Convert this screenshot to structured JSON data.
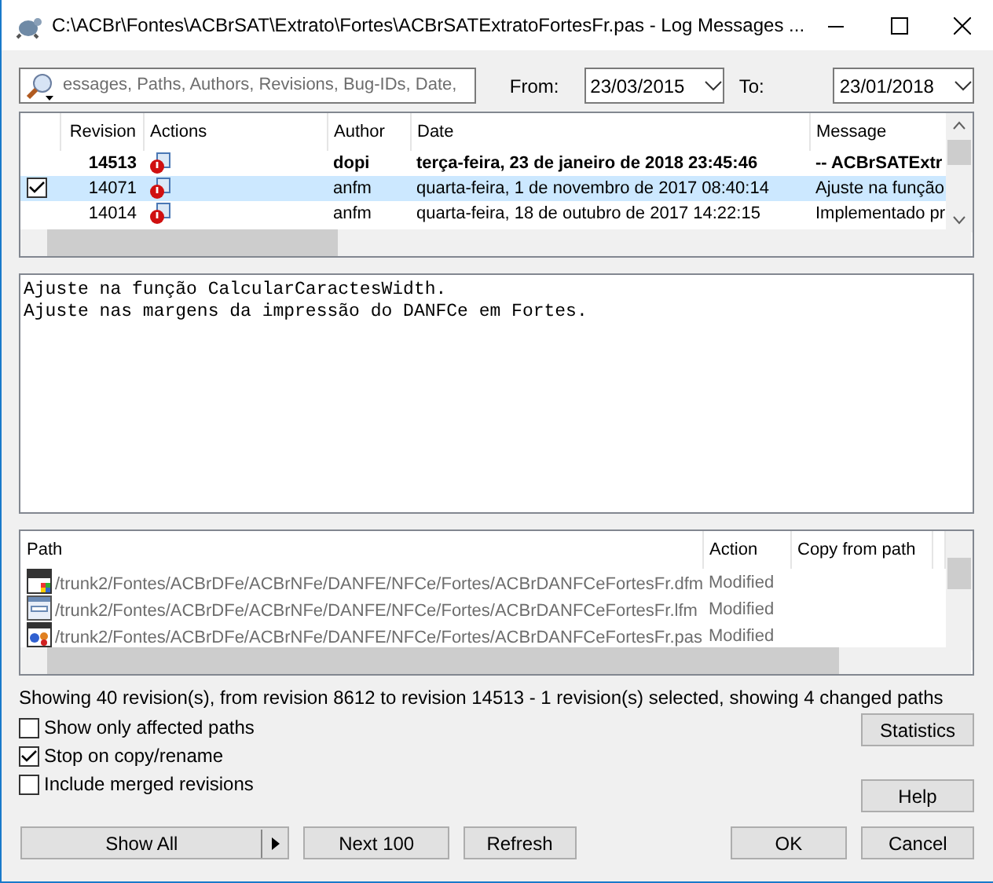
{
  "window": {
    "title": "C:\\ACBr\\Fontes\\ACBrSAT\\Extrato\\Fortes\\ACBrSATExtratoFortesFr.pas - Log Messages ..."
  },
  "filter": {
    "placeholder": "essages, Paths, Authors, Revisions, Bug-IDs, Date,"
  },
  "date_from": {
    "label": "From:",
    "value": "23/03/2015"
  },
  "date_to": {
    "label": "To:",
    "value": "23/01/2018"
  },
  "revisions": {
    "columns": [
      "Revision",
      "Actions",
      "Author",
      "Date",
      "Message"
    ],
    "rows": [
      {
        "revision": "14513",
        "author": "dopi",
        "date": "terça-feira, 23 de janeiro de 2018 23:45:46",
        "message": "-- ACBrSATExtr",
        "bold": true,
        "checked": false,
        "selected": false
      },
      {
        "revision": "14071",
        "author": "anfm",
        "date": "quarta-feira, 1 de novembro de 2017 08:40:14",
        "message": "Ajuste na função",
        "bold": false,
        "checked": true,
        "selected": true
      },
      {
        "revision": "14014",
        "author": "anfm",
        "date": "quarta-feira, 18 de outubro de 2017 14:22:15",
        "message": "Implementado pr",
        "bold": false,
        "checked": false,
        "selected": false
      }
    ]
  },
  "message": [
    "Ajuste na função CalcularCaractesWidth.",
    "Ajuste nas margens da impressão do DANFCe em Fortes."
  ],
  "paths": {
    "columns": [
      "Path",
      "Action",
      "Copy from path"
    ],
    "rows": [
      {
        "kind": "dfm",
        "path": "/trunk2/Fontes/ACBrDFe/ACBrNFe/DANFE/NFCe/Fortes/ACBrDANFCeFortesFr.dfm",
        "action": "Modified"
      },
      {
        "kind": "lfm",
        "path": "/trunk2/Fontes/ACBrDFe/ACBrNFe/DANFE/NFCe/Fortes/ACBrDANFCeFortesFr.lfm",
        "action": "Modified"
      },
      {
        "kind": "pas",
        "path": "/trunk2/Fontes/ACBrDFe/ACBrNFe/DANFE/NFCe/Fortes/ACBrDANFCeFortesFr.pas",
        "action": "Modified"
      }
    ]
  },
  "status": "Showing 40 revision(s), from revision 8612 to revision 14513 - 1 revision(s) selected, showing 4 changed paths",
  "options": [
    {
      "label": "Show only affected paths",
      "checked": false
    },
    {
      "label": "Stop on copy/rename",
      "checked": true
    },
    {
      "label": "Include merged revisions",
      "checked": false
    }
  ],
  "side_buttons": [
    "Statistics",
    "Help"
  ],
  "buttons": [
    {
      "label": "Show All",
      "kind": "split"
    },
    {
      "label": "Next 100",
      "kind": "plain"
    },
    {
      "label": "Refresh",
      "kind": "plain"
    },
    {
      "label": "OK",
      "kind": "plain"
    },
    {
      "label": "Cancel",
      "kind": "plain"
    }
  ]
}
